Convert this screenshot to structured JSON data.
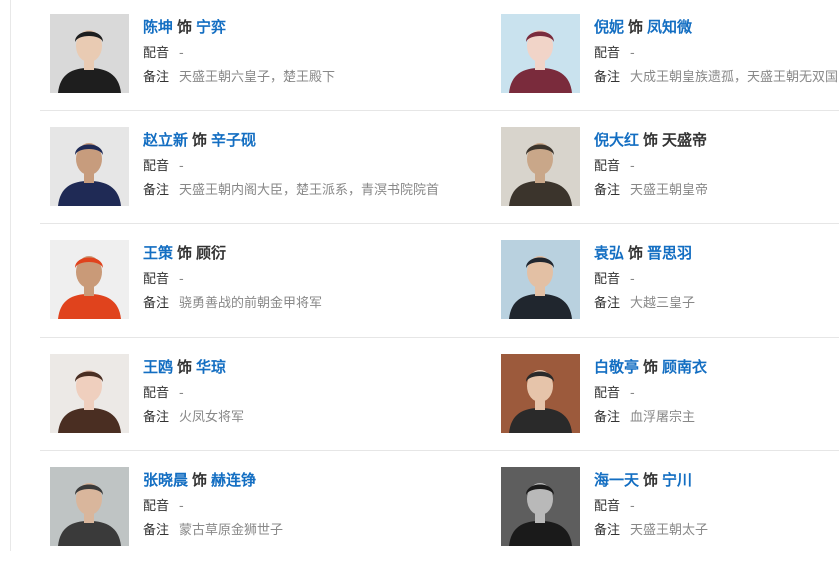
{
  "colors": {
    "link": "#136ec2",
    "text": "#333333",
    "muted": "#888888",
    "divider": "#e6e6e6"
  },
  "labels": {
    "plays": "饰",
    "dubbing": "配音",
    "note": "备注"
  },
  "rows": [
    {
      "left": {
        "actor": "陈坤",
        "role": "宁弈",
        "role_link": true,
        "dubbing": "-",
        "note": "天盛王朝六皇子，楚王殿下",
        "photo": {
          "bg": "#d9d9d9",
          "fg": "#1e1e1e",
          "skin": "#e9cbb3"
        }
      },
      "right": {
        "actor": "倪妮",
        "role": "凤知微",
        "role_link": true,
        "dubbing": "-",
        "note": "大成王朝皇族遗孤，天盛王朝无双国",
        "photo": {
          "bg": "#c9e2ee",
          "fg": "#7a2b3c",
          "skin": "#f1d4c8"
        }
      }
    },
    {
      "left": {
        "actor": "赵立新",
        "role": "辛子砚",
        "role_link": true,
        "dubbing": "-",
        "note": "天盛王朝内阁大臣，楚王派系，青溟书院院首",
        "photo": {
          "bg": "#e6e6e6",
          "fg": "#1f2a55",
          "skin": "#c79c7d"
        }
      },
      "right": {
        "actor": "倪大红",
        "role": "天盛帝",
        "role_link": false,
        "dubbing": "-",
        "note": "天盛王朝皇帝",
        "photo": {
          "bg": "#d8d4cc",
          "fg": "#3b342c",
          "skin": "#c9a789"
        }
      }
    },
    {
      "left": {
        "actor": "王策",
        "role": "顾衍",
        "role_link": false,
        "dubbing": "-",
        "note": "骁勇善战的前朝金甲将军",
        "photo": {
          "bg": "#efefef",
          "fg": "#e0431d",
          "skin": "#c99a78"
        }
      },
      "right": {
        "actor": "袁弘",
        "role": "晋思羽",
        "role_link": true,
        "dubbing": "-",
        "note": "大越三皇子",
        "photo": {
          "bg": "#b9d1df",
          "fg": "#20262e",
          "skin": "#e3c0a4"
        }
      }
    },
    {
      "left": {
        "actor": "王鸥",
        "role": "华琼",
        "role_link": true,
        "dubbing": "-",
        "note": "火凤女将军",
        "photo": {
          "bg": "#ece9e6",
          "fg": "#4a2e22",
          "skin": "#efcfbe"
        }
      },
      "right": {
        "actor": "白敬亭",
        "role": "顾南衣",
        "role_link": true,
        "dubbing": "-",
        "note": "血浮屠宗主",
        "photo": {
          "bg": "#9c5a3c",
          "fg": "#2a2a2a",
          "skin": "#e6c4aa"
        }
      }
    },
    {
      "left": {
        "actor": "张晓晨",
        "role": "赫连铮",
        "role_link": true,
        "dubbing": "-",
        "note": "蒙古草原金狮世子",
        "photo": {
          "bg": "#bfc4c4",
          "fg": "#3a3a3a",
          "skin": "#d9b69c"
        }
      },
      "right": {
        "actor": "海一天",
        "role": "宁川",
        "role_link": true,
        "dubbing": "-",
        "note": "天盛王朝太子",
        "photo": {
          "bg": "#5e5e5e",
          "fg": "#1a1a1a",
          "skin": "#b9b9b9"
        }
      }
    }
  ]
}
